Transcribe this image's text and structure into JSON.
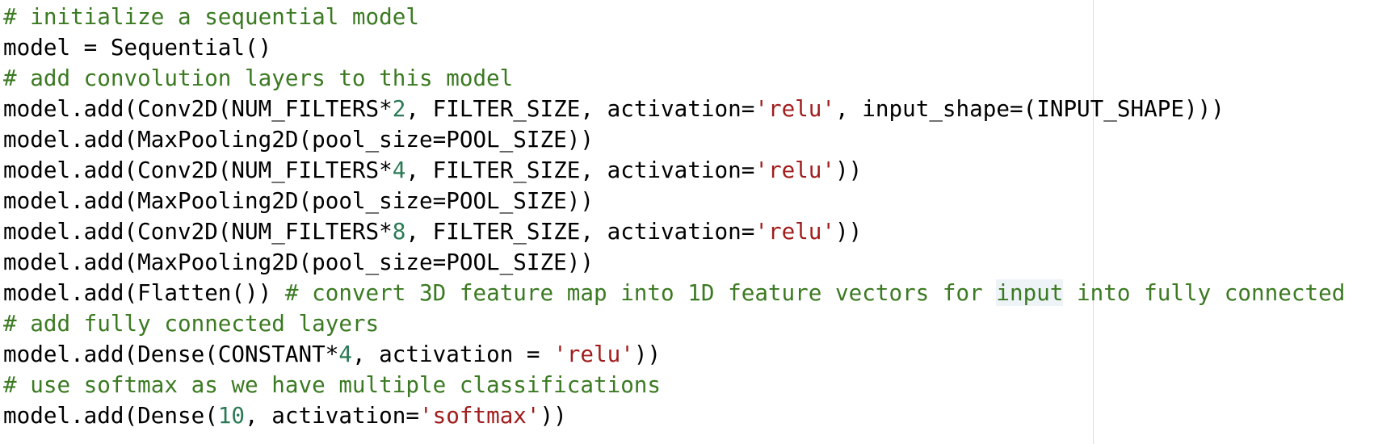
{
  "editor": {
    "language": "python",
    "colors": {
      "background": "#ffffff",
      "default_text": "#000000",
      "comment": "#3b7a22",
      "string": "#a11d1d",
      "number": "#2b7a55",
      "word_highlight": "#eef3f8",
      "ruler": "#dcdcdc"
    },
    "lines": [
      [
        {
          "type": "comment",
          "text": "# initialize a sequential model"
        }
      ],
      [
        {
          "type": "code",
          "text": "model = Sequential()"
        }
      ],
      [
        {
          "type": "comment",
          "text": "# add convolution layers to this model"
        }
      ],
      [
        {
          "type": "code",
          "text": "model.add(Conv2D(NUM_FILTERS*"
        },
        {
          "type": "number",
          "text": "2"
        },
        {
          "type": "code",
          "text": ", FILTER_SIZE, activation="
        },
        {
          "type": "string",
          "text": "'relu'"
        },
        {
          "type": "code",
          "text": ", input_shape=(INPUT_SHAPE)))"
        }
      ],
      [
        {
          "type": "code",
          "text": "model.add(MaxPooling2D(pool_size=POOL_SIZE))"
        }
      ],
      [
        {
          "type": "code",
          "text": "model.add(Conv2D(NUM_FILTERS*"
        },
        {
          "type": "number",
          "text": "4"
        },
        {
          "type": "code",
          "text": ", FILTER_SIZE, activation="
        },
        {
          "type": "string",
          "text": "'relu'"
        },
        {
          "type": "code",
          "text": "))"
        }
      ],
      [
        {
          "type": "code",
          "text": "model.add(MaxPooling2D(pool_size=POOL_SIZE))"
        }
      ],
      [
        {
          "type": "code",
          "text": "model.add(Conv2D(NUM_FILTERS*"
        },
        {
          "type": "number",
          "text": "8"
        },
        {
          "type": "code",
          "text": ", FILTER_SIZE, activation="
        },
        {
          "type": "string",
          "text": "'relu'"
        },
        {
          "type": "code",
          "text": "))"
        }
      ],
      [
        {
          "type": "code",
          "text": "model.add(MaxPooling2D(pool_size=POOL_SIZE))"
        }
      ],
      [
        {
          "type": "code",
          "text": "model.add(Flatten()) "
        },
        {
          "type": "comment",
          "text": "# convert 3D feature map into 1D feature vectors for "
        },
        {
          "type": "comment",
          "text": "input",
          "highlight": true
        },
        {
          "type": "comment",
          "text": " into fully connected"
        }
      ],
      [
        {
          "type": "comment",
          "text": "# add fully connected layers"
        }
      ],
      [
        {
          "type": "code",
          "text": "model.add(Dense(CONSTANT*"
        },
        {
          "type": "number",
          "text": "4"
        },
        {
          "type": "code",
          "text": ", activation = "
        },
        {
          "type": "string",
          "text": "'relu'"
        },
        {
          "type": "code",
          "text": "))"
        }
      ],
      [
        {
          "type": "comment",
          "text": "# use softmax as we have multiple classifications"
        }
      ],
      [
        {
          "type": "code",
          "text": "model.add(Dense("
        },
        {
          "type": "number",
          "text": "10"
        },
        {
          "type": "code",
          "text": ", activation="
        },
        {
          "type": "string",
          "text": "'softmax'"
        },
        {
          "type": "code",
          "text": "))"
        }
      ]
    ]
  }
}
